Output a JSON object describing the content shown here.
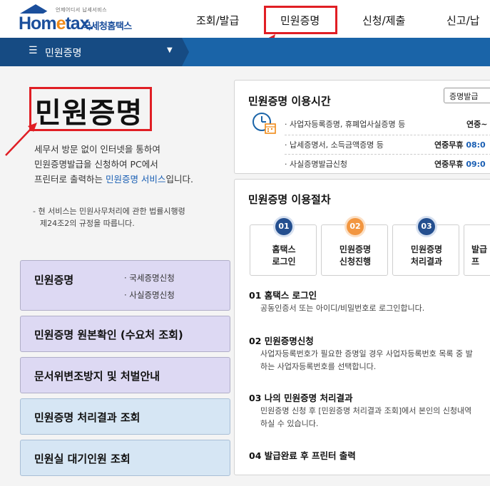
{
  "header": {
    "logo": {
      "sub": "언제어디서 납세서비스",
      "main_a": "Hom",
      "main_e": "e",
      "main_b": "tax.",
      "kr": "국세청홈택스"
    },
    "nav": [
      "조회/발급",
      "민원증명",
      "신청/제출",
      "신고/납"
    ]
  },
  "menu_bar": {
    "title": "민원증명"
  },
  "left": {
    "title": "민원증명",
    "desc": [
      "세무서 방문 없이 인터넷을 통하여",
      "민원증명발급을 신청하여 PC에서",
      "프린터로 출력하는 "
    ],
    "desc_link": "민원증명 서비스",
    "desc_tail": "입니다.",
    "note": [
      "- 현 서비스는 민원사무처리에 관한 법률시행령",
      "제24조2의 규정을 따릅니다."
    ],
    "buttons": [
      {
        "label": "민원증명",
        "subs": [
          "· 국세증명신청",
          "· 사실증명신청"
        ]
      },
      {
        "label": "민원증명 원본확인 (수요처 조회)"
      },
      {
        "label": "문서위변조방지 및 처벌안내"
      },
      {
        "label": "민원증명 처리결과 조회"
      },
      {
        "label": "민원실 대기인원 조회"
      }
    ]
  },
  "hours": {
    "title": "민원증명 이용시간",
    "button": "증명발급",
    "rows": [
      {
        "label": "· 사업자등록증명, 휴폐업사실증명 등",
        "time": "연중~"
      },
      {
        "label": "· 납세증명서, 소득금액증명 등",
        "time": "연중무휴 ",
        "hour": "08:0"
      },
      {
        "label": "· 사실증명발급신청",
        "time": "연중무휴 ",
        "hour": "09:0"
      }
    ]
  },
  "procedure": {
    "title": "민원증명 이용절차",
    "steps": [
      {
        "num": "01",
        "line1": "홈택스",
        "line2": "로그인"
      },
      {
        "num": "02",
        "line1": "민원증명",
        "line2": "신청진행"
      },
      {
        "num": "03",
        "line1": "민원증명",
        "line2": "처리결과"
      },
      {
        "num": "04",
        "line1": "발급",
        "line2": "프"
      }
    ],
    "details": [
      {
        "head": "01 홈택스 로그인",
        "lines": [
          "공동인증서 또는 아이디/비밀번호로 로그인합니다."
        ]
      },
      {
        "head": "02 민원증명신청",
        "lines": [
          "사업자등록번호가 필요한 증명일 경우 사업자등록번호 목록 중 발",
          "하는 사업자등록번호를 선택합니다."
        ]
      },
      {
        "head": "03 나의 민원증명 처리결과",
        "lines": [
          "민원증명 신청 후 [민원증명 처리결과 조회]에서 본인의 신청내역",
          "하실 수 있습니다."
        ]
      },
      {
        "head": "04 발급완료 후 프린터 출력",
        "lines": []
      }
    ]
  },
  "colors": {
    "brand_blue": "#1b4f9c",
    "accent_orange": "#f08a18",
    "highlight_red": "#e01e24",
    "bar_blue": "#1a64a8"
  }
}
